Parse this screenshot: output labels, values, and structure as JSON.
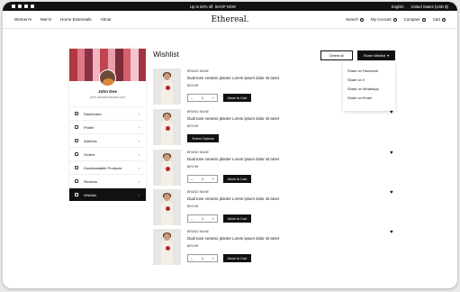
{
  "topbar": {
    "promo": "Up to 50% off. SHOP NOW",
    "language": "English",
    "currency": "United States (USD $)"
  },
  "nav": {
    "links": [
      "Women's",
      "Men's",
      "Home Essentials",
      "About"
    ],
    "logo": "Ethereal.",
    "search": "Search",
    "account": "My Account",
    "compare": "Compare",
    "cart": "Cart"
  },
  "profile": {
    "name": "John Doe",
    "email": "john.doe@example.com"
  },
  "menu": [
    "Dashboard",
    "Profile",
    "Address",
    "Orders",
    "Downloadable Products",
    "Reviews",
    "Wishlist"
  ],
  "wishlist": {
    "title": "Wishlist",
    "delete_all": "Delete All",
    "share": "Share Wishlist",
    "share_options": [
      "Share on Facebook",
      "Share on X",
      "Share on WhatsApp",
      "Share on Email"
    ],
    "items": [
      {
        "brand": "BRAND NAME",
        "name": "Dual tone ceramic planter Lorem ipsum dolor sit amet",
        "price": "$29.99",
        "qty": "1",
        "action": "Move to Cart",
        "heart": false
      },
      {
        "brand": "BRAND NAME",
        "name": "Dual tone ceramic planter Lorem ipsum dolor sit amet",
        "price": "$29.99",
        "qty": "",
        "action": "Select Options",
        "heart": true
      },
      {
        "brand": "BRAND NAME",
        "name": "Dual tone ceramic planter Lorem ipsum dolor sit amet",
        "price": "$29.99",
        "qty": "1",
        "action": "Move to Cart",
        "heart": true
      },
      {
        "brand": "BRAND NAME",
        "name": "Dual tone ceramic planter Lorem ipsum dolor sit amet",
        "price": "$29.99",
        "qty": "1",
        "action": "Move to Cart",
        "heart": true
      },
      {
        "brand": "BRAND NAME",
        "name": "Dual tone ceramic planter Lorem ipsum dolor sit amet",
        "price": "$29.99",
        "qty": "1",
        "action": "Move to Cart",
        "heart": true
      }
    ]
  }
}
